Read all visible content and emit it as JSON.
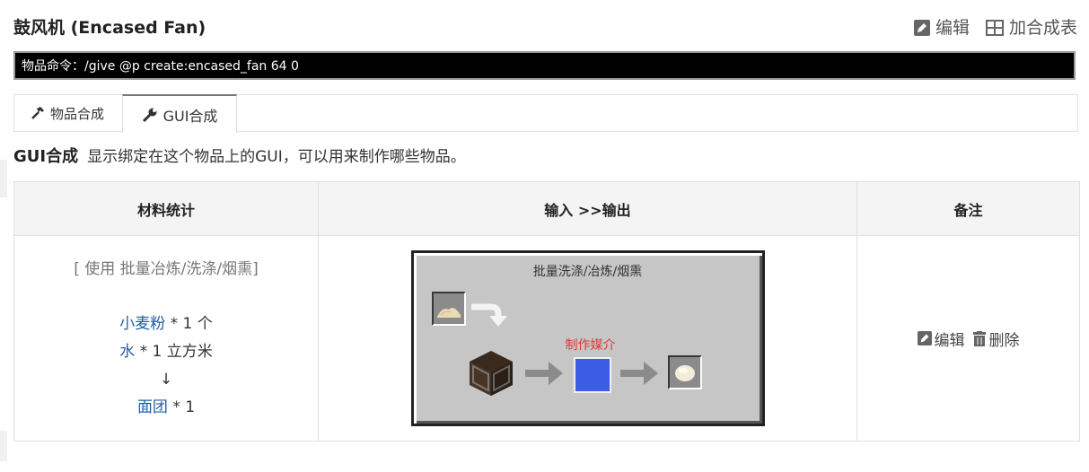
{
  "page": {
    "title": "鼓风机 (Encased Fan)",
    "actions": {
      "edit": "编辑",
      "add_table": "加合成表"
    }
  },
  "command": {
    "text": "物品命令：/give @p create:encased_fan 64 0"
  },
  "tabs": [
    {
      "label": "物品合成",
      "icon": "hammer-icon",
      "active": false
    },
    {
      "label": "GUI合成",
      "icon": "wrench-icon",
      "active": true
    }
  ],
  "section": {
    "heading": "GUI合成",
    "description": "显示绑定在这个物品上的GUI，可以用来制作哪些物品。"
  },
  "table": {
    "headers": [
      "材料统计",
      "输入 >>输出",
      "备注"
    ],
    "row": {
      "usage": "[ 使用 批量冶炼/洗涤/烟熏]",
      "materials": [
        {
          "name": "小麦粉",
          "amount": " * 1 个"
        },
        {
          "name": "水",
          "amount": " * 1 立方米"
        }
      ],
      "arrow": "↓",
      "result": {
        "name": "面团",
        "amount": " * 1"
      },
      "gui": {
        "title": "批量洗涤/冶炼/烟熏",
        "medium_label": "制作媒介",
        "medium_color": "#3d5ce4"
      },
      "notes": {
        "edit": "编辑",
        "delete": "删除"
      }
    }
  }
}
